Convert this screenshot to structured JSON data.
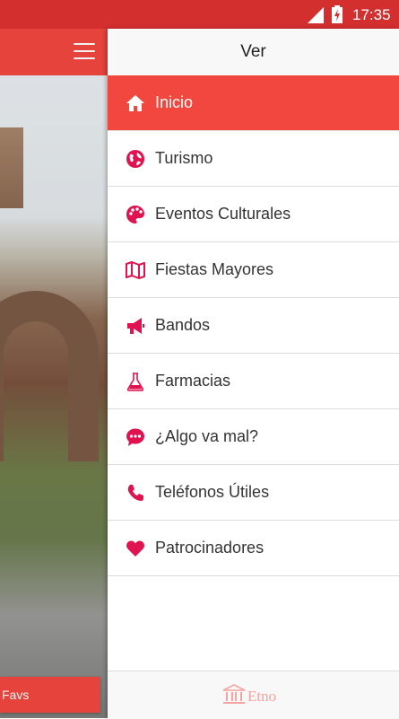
{
  "status_bar": {
    "time": "17:35"
  },
  "app": {
    "favs_label": "Favs"
  },
  "drawer": {
    "title": "Ver",
    "items": [
      {
        "label": "Inicio",
        "icon": "home-icon",
        "active": true
      },
      {
        "label": "Turismo",
        "icon": "globe-icon",
        "active": false
      },
      {
        "label": "Eventos Culturales",
        "icon": "palette-icon",
        "active": false
      },
      {
        "label": "Fiestas Mayores",
        "icon": "map-icon",
        "active": false
      },
      {
        "label": "Bandos",
        "icon": "megaphone-icon",
        "active": false
      },
      {
        "label": "Farmacias",
        "icon": "flask-icon",
        "active": false
      },
      {
        "label": "¿Algo va mal?",
        "icon": "chat-icon",
        "active": false
      },
      {
        "label": "Teléfonos Útiles",
        "icon": "phone-icon",
        "active": false
      },
      {
        "label": "Patrocinadores",
        "icon": "heart-icon",
        "active": false
      }
    ],
    "footer_brand": "Etno"
  },
  "colors": {
    "status_bar": "#d32f2f",
    "accent": "#f2473f",
    "icon": "#e0124f",
    "footer_brand": "#f4a3a0"
  }
}
